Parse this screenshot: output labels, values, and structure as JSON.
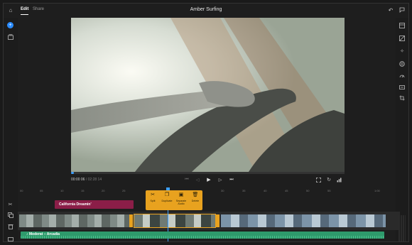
{
  "header": {
    "tabs": [
      {
        "label": "Edit"
      },
      {
        "label": "Share"
      }
    ],
    "project_title": "Amber Surfing"
  },
  "viewer": {
    "timecode_current": "00:00",
    "timecode_frames": "06",
    "timecode_total": "02:28",
    "timecode_total_frames": "14",
    "progress_fraction": 0.01
  },
  "ruler": {
    "ticks": [
      "00",
      "05",
      "10",
      "15",
      "20",
      "25",
      "30",
      "35",
      "40",
      "45",
      "50",
      "55",
      "1:00"
    ]
  },
  "clip_menu": {
    "split": "Split",
    "duplicate": "Duplicate",
    "separate_audio_1": "Separate",
    "separate_audio_2": "Audio",
    "delete": "Delete"
  },
  "timeline": {
    "title_clip": "California Dreamin'",
    "audio_clip": "Moderat – Arcadia"
  },
  "colors": {
    "accent": "#3ea0ff",
    "clip_menu": "#e8a21f",
    "title_clip": "#8b1e48",
    "audio_clip": "#2e9a6c"
  }
}
